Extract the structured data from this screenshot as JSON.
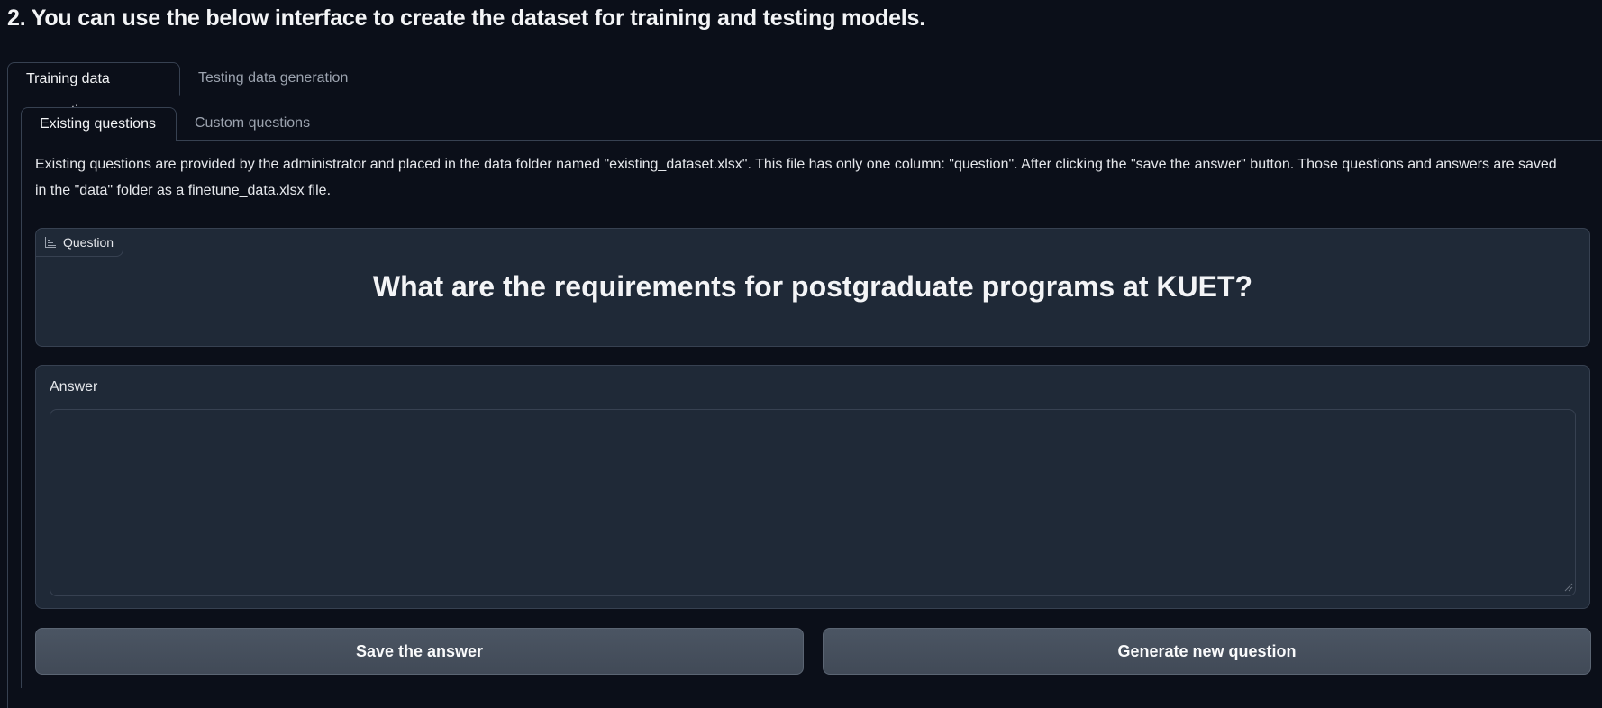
{
  "heading": "2. You can use the below interface to create the dataset for training and testing models.",
  "outer_tabs": [
    {
      "label": "Training data generation",
      "active": true
    },
    {
      "label": "Testing data generation",
      "active": false
    }
  ],
  "inner_tabs": [
    {
      "label": "Existing questions",
      "active": true
    },
    {
      "label": "Custom questions",
      "active": false
    }
  ],
  "description": "Existing questions are provided by the administrator and placed in the data folder named \"existing_dataset.xlsx\". This file has only one column: \"question\". After clicking the \"save the answer\" button. Those questions and answers are saved in the \"data\" folder as a finetune_data.xlsx file.",
  "question": {
    "label": "Question",
    "label_icon": "chart-icon",
    "text": "What are the requirements for postgraduate programs at KUET?"
  },
  "answer": {
    "label": "Answer",
    "value": "",
    "placeholder": ""
  },
  "buttons": {
    "save_label": "Save the answer",
    "generate_label": "Generate new question"
  },
  "colors": {
    "background": "#0b0f19",
    "panel": "#1f2937",
    "border": "#374151",
    "button": "#4b5563"
  }
}
